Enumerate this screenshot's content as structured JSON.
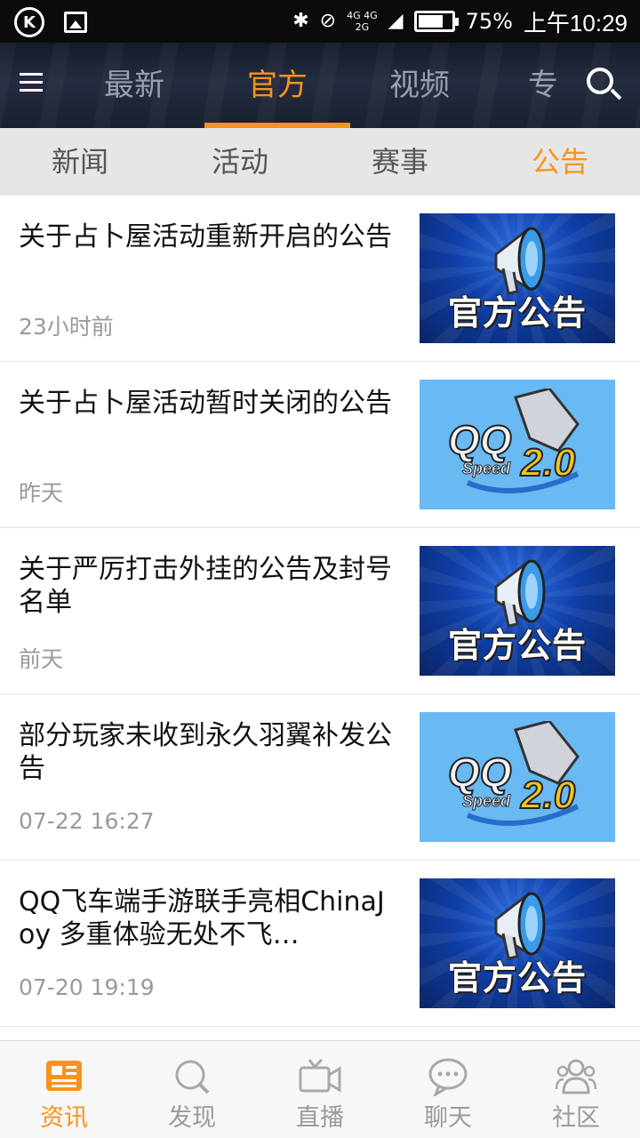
{
  "status_bar": {
    "network_top": "4G",
    "network_mid": "4G",
    "network_low": "2G",
    "battery": "75%",
    "time": "上午10:29"
  },
  "top_nav": {
    "tabs": [
      {
        "label": "最新"
      },
      {
        "label": "官方"
      },
      {
        "label": "视频"
      },
      {
        "label": "专栏"
      }
    ],
    "active_tab": "官方"
  },
  "sub_tabs": {
    "items": [
      {
        "label": "新闻"
      },
      {
        "label": "活动"
      },
      {
        "label": "赛事"
      },
      {
        "label": "公告"
      }
    ],
    "active": "公告"
  },
  "articles": [
    {
      "title": "关于占卜屋活动重新开启的公告",
      "time": "23小时前",
      "thumb_text": "官方公告"
    },
    {
      "title": "关于占卜屋活动暂时关闭的公告",
      "time": "昨天",
      "thumb_text": "Speed 2.0"
    },
    {
      "title": "关于严厉打击外挂的公告及封号名单",
      "time": "前天",
      "thumb_text": "官方公告"
    },
    {
      "title": "部分玩家未收到永久羽翼补发公告",
      "time": "07-22 16:27",
      "thumb_text": "Speed 2.0"
    },
    {
      "title": "QQ飞车端手游联手亮相ChinaJoy 多重体验无处不飞…",
      "time": "07-20 19:19",
      "thumb_text": "官方公告"
    }
  ],
  "bottom_nav": {
    "items": [
      {
        "label": "资讯",
        "icon": "news-icon"
      },
      {
        "label": "发现",
        "icon": "discover-icon"
      },
      {
        "label": "直播",
        "icon": "live-icon"
      },
      {
        "label": "聊天",
        "icon": "chat-icon"
      },
      {
        "label": "社区",
        "icon": "community-icon"
      }
    ],
    "active": "资讯"
  },
  "colors": {
    "accent": "#f7941d",
    "nav_bg": "#1e2536",
    "subtab_bg": "#e6e6e6"
  }
}
